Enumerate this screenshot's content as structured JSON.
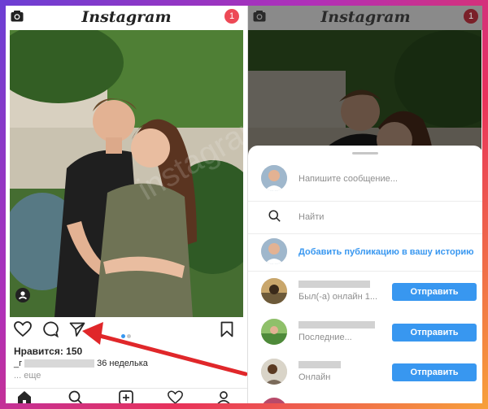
{
  "left": {
    "header": {
      "logo": "Instagram",
      "notifications": "1"
    },
    "post": {
      "likes": "Нравится: 150",
      "caption_prefix": "_г",
      "caption_suffix": "36 неделька",
      "more": "... еще"
    }
  },
  "right": {
    "header": {
      "logo": "Instagram",
      "notifications": "1"
    },
    "share_sheet": {
      "message_placeholder": "Напишите сообщение...",
      "search_placeholder": "Найти",
      "add_to_story": "Добавить публикацию в вашу историю",
      "contacts": [
        {
          "status": "Был(-а) онлайн 1...",
          "button": "Отправить"
        },
        {
          "status": "Последние...",
          "button": "Отправить"
        },
        {
          "status": "Онлайн",
          "button": "Отправить"
        }
      ]
    }
  },
  "watermark": "instagramm.ru",
  "colors": {
    "accent": "#3897f0",
    "badge": "#ed4956",
    "arrow": "#e0272a"
  }
}
